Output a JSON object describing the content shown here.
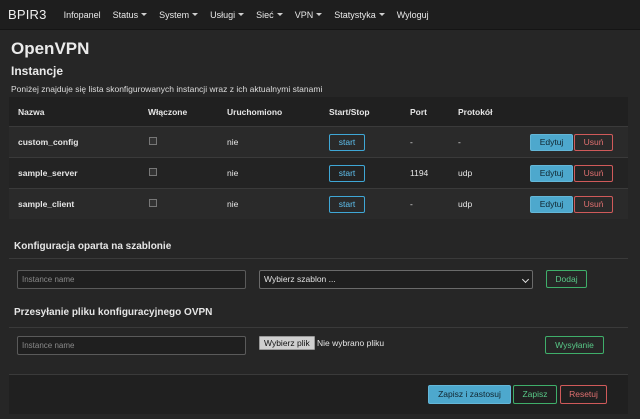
{
  "navbar": {
    "brand": "BPIR3",
    "items": [
      {
        "label": "Infopanel",
        "dropdown": false
      },
      {
        "label": "Status",
        "dropdown": true
      },
      {
        "label": "System",
        "dropdown": true
      },
      {
        "label": "Usługi",
        "dropdown": true
      },
      {
        "label": "Sieć",
        "dropdown": true
      },
      {
        "label": "VPN",
        "dropdown": true
      },
      {
        "label": "Statystyka",
        "dropdown": true
      },
      {
        "label": "Wyloguj",
        "dropdown": false
      }
    ]
  },
  "page": {
    "title": "OpenVPN",
    "section_title": "Instancje",
    "section_desc": "Poniżej znajduje się lista skonfigurowanych instancji wraz z ich aktualnymi stanami"
  },
  "table": {
    "headers": {
      "name": "Nazwa",
      "enabled": "Włączone",
      "running": "Uruchomiono",
      "startstop": "Start/Stop",
      "port": "Port",
      "protocol": "Protokół"
    },
    "rows": [
      {
        "name": "custom_config",
        "running": "nie",
        "start": "start",
        "port": "-",
        "protocol": "-",
        "edit": "Edytuj",
        "delete": "Usuń"
      },
      {
        "name": "sample_server",
        "running": "nie",
        "start": "start",
        "port": "1194",
        "protocol": "udp",
        "edit": "Edytuj",
        "delete": "Usuń"
      },
      {
        "name": "sample_client",
        "running": "nie",
        "start": "start",
        "port": "-",
        "protocol": "udp",
        "edit": "Edytuj",
        "delete": "Usuń"
      }
    ]
  },
  "template_config": {
    "title": "Konfiguracja oparta na szablonie",
    "name_placeholder": "Instance name",
    "select_value": "Wybierz szablon ...",
    "add_label": "Dodaj"
  },
  "upload_config": {
    "title": "Przesyłanie pliku konfiguracyjnego OVPN",
    "name_placeholder": "Instance name",
    "file_button": "Wybierz plik",
    "file_status": "Nie wybrano pliku",
    "upload_label": "Wysyłanie"
  },
  "footer": {
    "apply_label": "Zapisz i zastosuj",
    "save_label": "Zapisz",
    "reset_label": "Resetuj"
  },
  "colors": {
    "accent_blue": "#4da8cd",
    "accent_green": "#58c887",
    "accent_red": "#e07070"
  }
}
